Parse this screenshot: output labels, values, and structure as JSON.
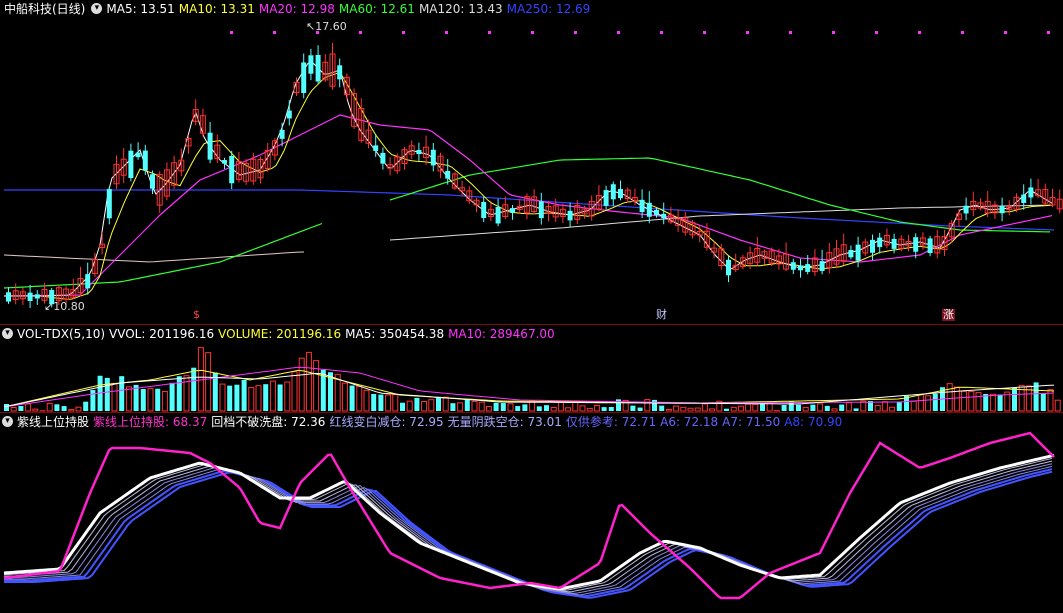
{
  "price_panel": {
    "title": "中船科技(日线)",
    "ma_labels": [
      {
        "text": "MA5: 13.51",
        "color": "#ffffff"
      },
      {
        "text": "MA10: 13.31",
        "color": "#ffff33"
      },
      {
        "text": "MA20: 12.98",
        "color": "#ff33ff"
      },
      {
        "text": "MA60: 12.61",
        "color": "#33ff33"
      },
      {
        "text": "MA120: 13.43",
        "color": "#dddddd"
      },
      {
        "text": "MA250: 12.69",
        "color": "#3344ff"
      }
    ],
    "high_label": "17.60",
    "low_label": "10.80",
    "markers": [
      {
        "text": "$",
        "color": "#ff4040"
      },
      {
        "text": "财",
        "color": "#c8c8ff"
      },
      {
        "text": "涨",
        "color": "#ffffff"
      }
    ]
  },
  "vol_panel": {
    "name": "VOL-TDX(5,10)",
    "labels": [
      {
        "text": "VVOL: 201196.16",
        "color": "#ffffff"
      },
      {
        "text": "VOLUME: 201196.16",
        "color": "#ffff33"
      },
      {
        "text": "MA5: 350454.38",
        "color": "#ffffff"
      },
      {
        "text": "MA10: 289467.00",
        "color": "#ff33ff"
      }
    ]
  },
  "ind_panel": {
    "name": "紫线上位持股",
    "labels": [
      {
        "text": "紫线上位持股: 68.37",
        "color": "#ff33cc"
      },
      {
        "text": "回档不破洗盘: 72.36",
        "color": "#ffffff"
      },
      {
        "text": "红线变白减仓: 72.95",
        "color": "#aaaaff"
      },
      {
        "text": "无量阴跌空仓: 73.01",
        "color": "#aaaaff"
      },
      {
        "text": "仅供参考: 72.71",
        "color": "#6666ff"
      },
      {
        "text": "A6: 72.18",
        "color": "#6666ff"
      },
      {
        "text": "A7: 71.50",
        "color": "#6666ff"
      },
      {
        "text": "A8: 70.90",
        "color": "#3344ff"
      }
    ]
  },
  "colors": {
    "up": "#ff3232",
    "down": "#54ffff",
    "ma5": "#ffffff",
    "ma10": "#ffff33",
    "ma20": "#ff33ff",
    "ma60": "#33ff33",
    "ma120": "#dddddd",
    "ma250": "#3344ff"
  }
}
